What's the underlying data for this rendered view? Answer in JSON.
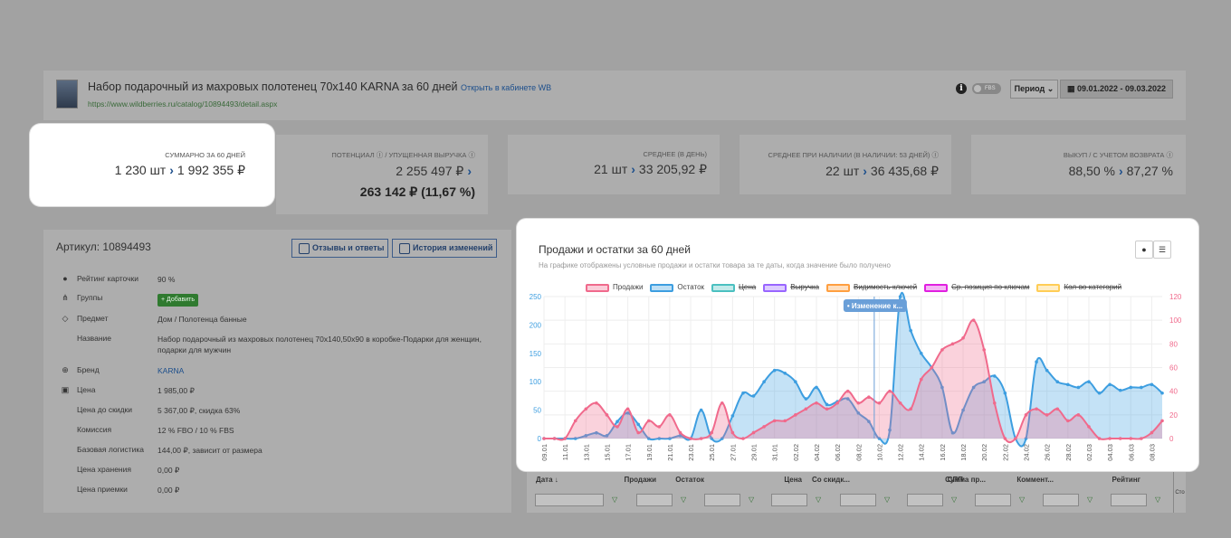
{
  "header": {
    "title": "Набор подарочный из махровых полотенец 70х140 KARNA за 60 дней",
    "open_link": "Открыть в кабинете WB",
    "url": "https://www.wildberries.ru/catalog/10894493/detail.aspx",
    "fbs_label": "FBS",
    "period_label": "Период",
    "date_range": "09.01.2022 - 09.03.2022"
  },
  "stats": [
    {
      "label": "СУММАРНО ЗА 60 ДНЕЙ",
      "qty": "1 230 шт",
      "value": "1 992 355 ₽"
    },
    {
      "label": "ПОТЕНЦИАЛ ⓘ / УПУЩЕННАЯ ВЫРУЧКА ⓘ",
      "qty": "",
      "value": "2 255 497 ₽",
      "extra": "263 142 ₽ (11,67 %)"
    },
    {
      "label": "СРЕДНЕЕ (В ДЕНЬ)",
      "qty": "21 шт",
      "value": "33 205,92 ₽"
    },
    {
      "label": "СРЕДНЕЕ ПРИ НАЛИЧИИ (В НАЛИЧИИ: 53 ДНЕЙ) ⓘ",
      "qty": "22 шт",
      "value": "36 435,68 ₽"
    },
    {
      "label": "ВЫКУП / С УЧЕТОМ ВОЗВРАТА ⓘ",
      "qty": "88,50 %",
      "value": "87,27 %"
    }
  ],
  "article": {
    "title": "Артикул: 10894493",
    "btn_reviews": "Отзывы и ответы",
    "btn_history": "История изменений",
    "rows": [
      {
        "key": "Рейтинг карточки",
        "value": "90 %",
        "icon": "●"
      },
      {
        "key": "Группы",
        "value": "",
        "icon": "⋔",
        "add": "+ Добавить"
      },
      {
        "key": "Предмет",
        "value": "Дом / Полотенца банные",
        "icon": "◇"
      },
      {
        "key": "Название",
        "value": "Набор подарочный из махровых полотенец 70х140,50х90 в коробке-Подарки для женщин, подарки для мужчин",
        "icon": ""
      },
      {
        "key": "Бренд",
        "value": "KARNA",
        "icon": "⊕"
      },
      {
        "key": "Цена",
        "value": "1 985,00 ₽",
        "icon": "▣"
      },
      {
        "key": "Цена до скидки",
        "value": "5 367,00 ₽, скидка 63%",
        "icon": ""
      },
      {
        "key": "Комиссия",
        "value": "12 % FBO / 10 % FBS",
        "icon": ""
      },
      {
        "key": "Базовая логистика",
        "value": "144,00 ₽, зависит от размера",
        "icon": ""
      },
      {
        "key": "Цена хранения",
        "value": "0,00 ₽",
        "icon": ""
      },
      {
        "key": "Цена приемки",
        "value": "0,00 ₽",
        "icon": ""
      }
    ]
  },
  "chart": {
    "title": "Продажи и остатки за 60 дней",
    "subtitle": "На графике отображены условные продажи и остатки товара за те даты, когда значение было получено",
    "tooltip": "• Изменение к...",
    "legend": [
      {
        "name": "Продажи",
        "color": "#f06a8c",
        "active": true
      },
      {
        "name": "Остаток",
        "color": "#3d9ee0",
        "active": true
      },
      {
        "name": "Цена",
        "color": "#4bc0c0",
        "active": false
      },
      {
        "name": "Выручка",
        "color": "#9966ff",
        "active": false
      },
      {
        "name": "Видимость ключей",
        "color": "#ff9f40",
        "active": false
      },
      {
        "name": "Ср. позиция по ключам",
        "color": "#e020e0",
        "active": false
      },
      {
        "name": "Кол-во категорий",
        "color": "#ffcd56",
        "active": false
      }
    ]
  },
  "chart_data": {
    "type": "area",
    "x": [
      "09.01",
      "10.01",
      "11.01",
      "12.01",
      "13.01",
      "14.01",
      "15.01",
      "16.01",
      "17.01",
      "18.01",
      "19.01",
      "20.01",
      "21.01",
      "22.01",
      "23.01",
      "24.01",
      "25.01",
      "26.01",
      "27.01",
      "28.01",
      "29.01",
      "30.01",
      "31.01",
      "01.02",
      "02.02",
      "03.02",
      "04.02",
      "05.02",
      "06.02",
      "07.02",
      "08.02",
      "09.02",
      "10.02",
      "11.02",
      "12.02",
      "13.02",
      "14.02",
      "15.02",
      "16.02",
      "17.02",
      "18.02",
      "19.02",
      "20.02",
      "21.02",
      "22.02",
      "23.02",
      "24.02",
      "25.02",
      "26.02",
      "27.02",
      "28.02",
      "01.03",
      "02.03",
      "03.03",
      "04.03",
      "05.03",
      "06.03",
      "07.03",
      "08.03",
      "09.03"
    ],
    "x_tick_labels": [
      "09.01",
      "11.01",
      "13.01",
      "15.01",
      "17.01",
      "19.01",
      "21.01",
      "23.01",
      "25.01",
      "27.01",
      "29.01",
      "31.01",
      "02.02",
      "04.02",
      "06.02",
      "08.02",
      "10.02",
      "12.02",
      "14.02",
      "16.02",
      "18.02",
      "20.02",
      "22.02",
      "24.02",
      "26.02",
      "28.02",
      "02.03",
      "04.03",
      "06.03",
      "08.03"
    ],
    "series": [
      {
        "name": "Остаток",
        "axis": "left",
        "color": "#3d9ee0",
        "values": [
          0,
          0,
          0,
          0,
          5,
          10,
          5,
          30,
          45,
          25,
          0,
          0,
          0,
          5,
          0,
          50,
          0,
          0,
          40,
          80,
          75,
          100,
          120,
          115,
          100,
          70,
          90,
          60,
          65,
          70,
          45,
          30,
          0,
          15,
          250,
          190,
          150,
          125,
          90,
          10,
          50,
          90,
          100,
          110,
          80,
          0,
          0,
          135,
          120,
          100,
          95,
          90,
          100,
          80,
          95,
          85,
          90,
          90,
          95,
          80
        ]
      },
      {
        "name": "Продажи",
        "axis": "right",
        "color": "#f06a8c",
        "values": [
          0,
          0,
          0,
          15,
          25,
          30,
          20,
          10,
          25,
          5,
          15,
          10,
          20,
          5,
          0,
          0,
          5,
          30,
          5,
          0,
          5,
          10,
          15,
          15,
          20,
          25,
          30,
          25,
          30,
          40,
          30,
          35,
          30,
          40,
          30,
          25,
          50,
          60,
          75,
          80,
          85,
          100,
          75,
          30,
          0,
          0,
          20,
          25,
          20,
          25,
          15,
          20,
          10,
          0,
          0,
          0,
          0,
          0,
          5,
          15
        ]
      }
    ],
    "ylim_left": [
      0,
      250
    ],
    "ylim_right": [
      0,
      120
    ],
    "yticks_left": [
      "250",
      "200",
      "150",
      "100",
      "50",
      "0"
    ],
    "yticks_right": [
      "120",
      "100",
      "80",
      "60",
      "40",
      "20",
      "0"
    ]
  },
  "table": {
    "columns": [
      "Дата ↓",
      "Продажи",
      "Остаток",
      "Цена",
      "Со скидк...",
      "СПП",
      "Сумма пр...",
      "Коммент...",
      "Рейтинг"
    ],
    "side": "Сто"
  }
}
